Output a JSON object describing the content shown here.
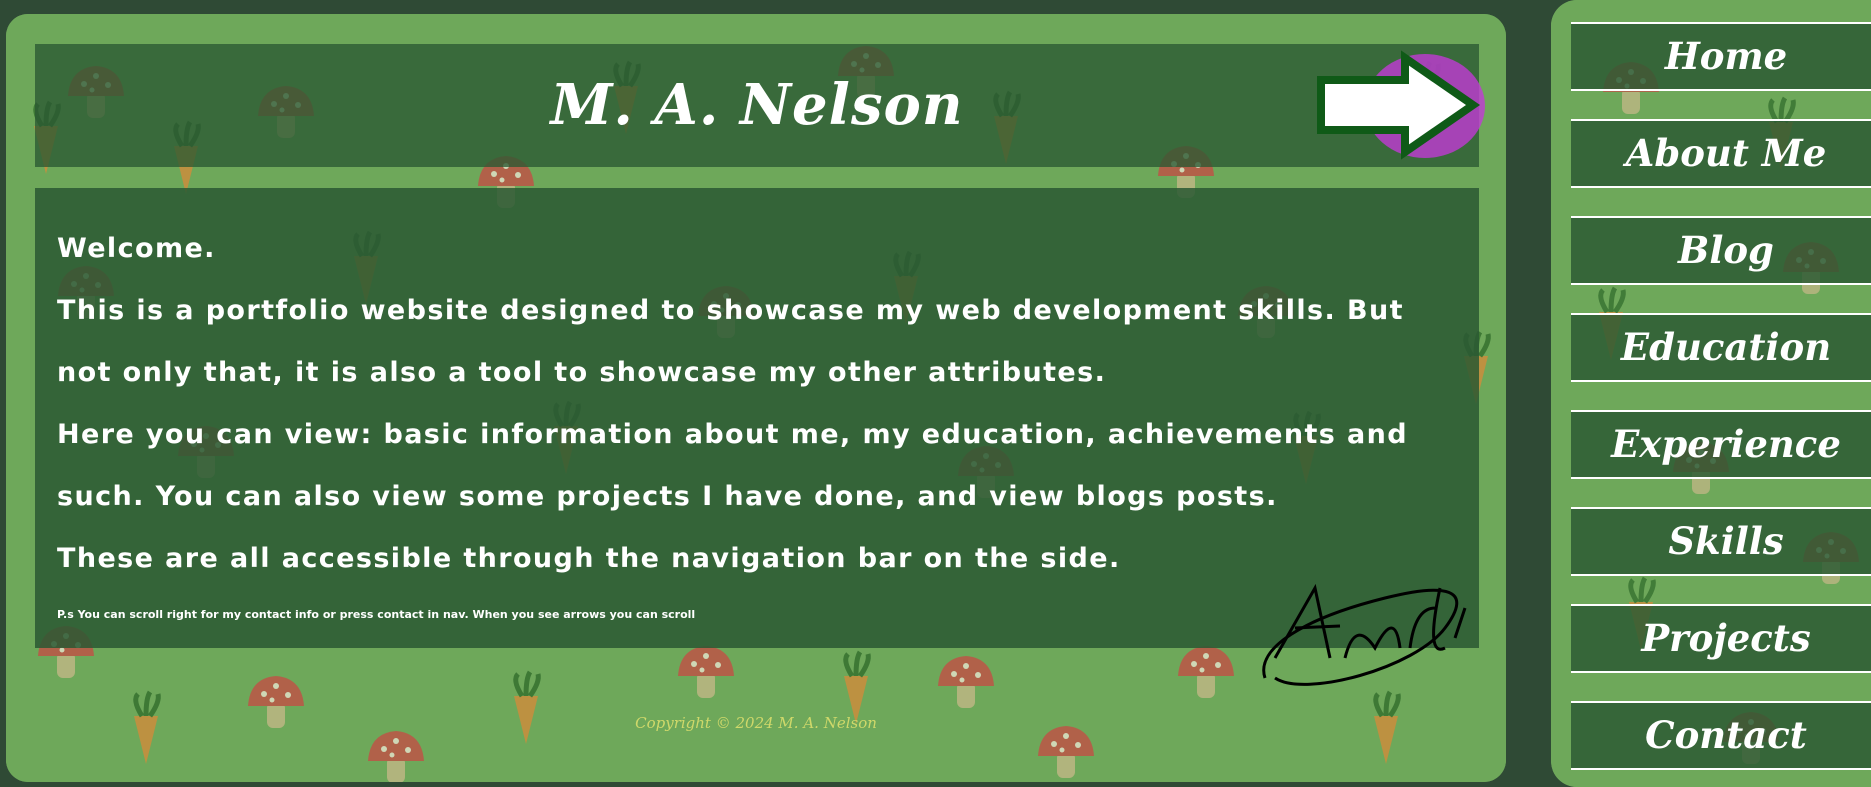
{
  "header": {
    "site_title": "M. A. Nelson"
  },
  "content": {
    "paragraphs": [
      "Welcome.",
      "This is a portfolio website designed to showcase my web development skills. But not only that, it is also a tool to showcase my other attributes.",
      "Here you can view: basic information about me, my education, achievements and such. You can also view some projects I have done, and view blogs posts.",
      "These are all accessible through the navigation bar on the side."
    ],
    "ps_note": "P.s You can scroll right for my contact info or press contact in nav. When you see arrows you can scroll",
    "signature_icon": "signature-icon"
  },
  "footer": {
    "copyright": "Copyright © 2024 M. A. Nelson"
  },
  "nav": {
    "items": [
      {
        "label": "Home"
      },
      {
        "label": "About Me"
      },
      {
        "label": "Blog"
      },
      {
        "label": "Education"
      },
      {
        "label": "Experience"
      },
      {
        "label": "Skills"
      },
      {
        "label": "Projects"
      },
      {
        "label": "Contact"
      }
    ]
  },
  "icons": {
    "scroll_arrow": "right-arrow-icon"
  },
  "colors": {
    "page_background": "#2f4a35",
    "panel_green": "#6ea85a",
    "box_green": "#2a5832",
    "arrow_outline": "#0f5a17",
    "arrow_glow": "#c23ad6",
    "copyright_text": "#cfd86a"
  }
}
